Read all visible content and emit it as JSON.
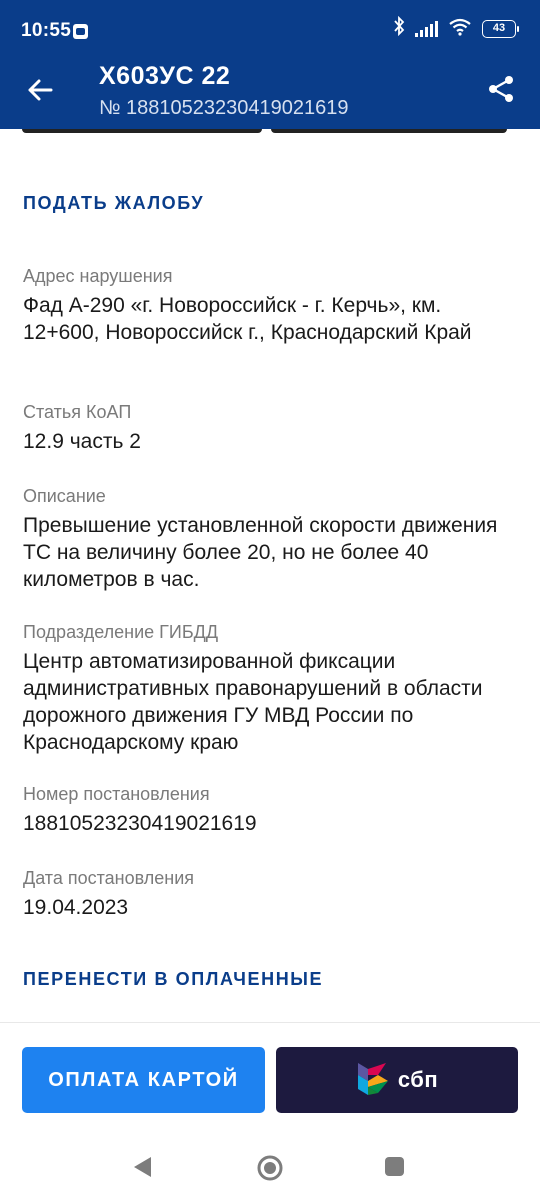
{
  "status_bar": {
    "time": "10:55",
    "battery": "43",
    "icons": [
      "notification-icon",
      "bluetooth-icon",
      "signal-icon",
      "wifi-icon",
      "battery-icon"
    ]
  },
  "header": {
    "title": "Х603УС 22",
    "subtitle": "№ 18810523230419021619",
    "back_icon": "arrow-left-icon",
    "share_icon": "share-icon"
  },
  "actions": {
    "complaint": "ПОДАТЬ ЖАЛОБУ",
    "move_paid": "ПЕРЕНЕСТИ В ОПЛАЧЕННЫЕ"
  },
  "details": [
    {
      "label": "Адрес нарушения",
      "value": "Фад А-290 «г. Новороссийск - г. Керчь», км. 12+600, Новороссийск г., Краснодарский Край"
    },
    {
      "label": "Статья КоАП",
      "value": "12.9 часть 2"
    },
    {
      "label": "Описание",
      "value": "Превышение установленной скорости движения ТС на величину более 20, но не более 40 километров в час."
    },
    {
      "label": "Подразделение ГИБДД",
      "value": "Центр автоматизированной фиксации административных правонарушений в области дорожного движения ГУ МВД России по Краснодарскому краю"
    },
    {
      "label": "Номер постановления",
      "value": "18810523230419021619"
    },
    {
      "label": "Дата постановления",
      "value": "19.04.2023"
    }
  ],
  "payment": {
    "card_label": "ОПЛАТА КАРТОЙ",
    "sbp_label": "сбп"
  },
  "colors": {
    "header_bg": "#0a3d8a",
    "link": "#0a3d8a",
    "card_button": "#1e82f0",
    "sbp_button": "#1d1a3f"
  }
}
